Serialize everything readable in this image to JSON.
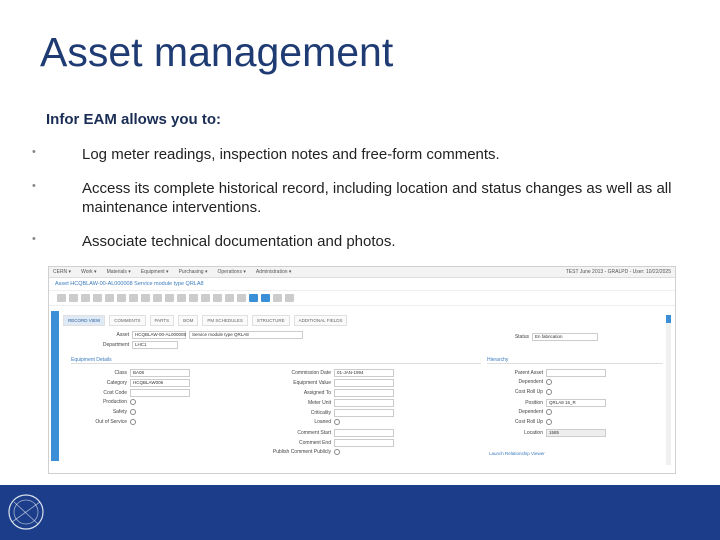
{
  "slide": {
    "title": "Asset management",
    "intro": "Infor EAM allows you to:",
    "bullets": [
      "Log meter readings, inspection notes and free-form comments.",
      "Access its complete historical record, including location and status changes as well as all maintenance interventions.",
      "Associate technical documentation and photos."
    ],
    "bullet_glyph": "•"
  },
  "screenshot": {
    "menu": [
      "CERN ▾",
      "Work ▾",
      "Materials ▾",
      "Equipment ▾",
      "Purchasing ▾",
      "Operations ▾",
      "Administration ▾"
    ],
    "session": "TEST June 2013 - GRALPD - User: 10/22/2025",
    "breadcrumb": "Asset HCQBLAW-00-AL000008 Service module type QRLA8",
    "tabs": [
      "RECORD VIEW",
      "COMMENTS",
      "PARTS",
      "BOM",
      "PM SCHEDULES",
      "STRUCTURE",
      "ADDITIONAL FIELDS"
    ],
    "active_tab": "RECORD VIEW",
    "asset_label": "Asset",
    "asset_code": "HCQBLAW-00-AL000008",
    "asset_desc": "Service module type QRLA8",
    "dept_label": "Department",
    "dept_value": "LHC1",
    "status_label": "Status",
    "status_value": "En fabrication",
    "section_equipment": "Equipment Details",
    "section_hierarchy": "Hierarchy",
    "left_fields": [
      {
        "label": "Class",
        "value": "BA08"
      },
      {
        "label": "Category",
        "value": "HCQBLAW006"
      },
      {
        "label": "Cost Code",
        "value": ""
      },
      {
        "label": "Production",
        "value": ""
      },
      {
        "label": "Safety",
        "value": ""
      },
      {
        "label": "Out of Service",
        "value": ""
      }
    ],
    "mid_fields": [
      {
        "label": "Commission Date",
        "value": "01-JAN-1994"
      },
      {
        "label": "Equipment Value",
        "value": ""
      },
      {
        "label": "Assigned To",
        "value": ""
      },
      {
        "label": "Meter Unit",
        "value": ""
      },
      {
        "label": "Criticality",
        "value": ""
      },
      {
        "label": "Loaned",
        "value": ""
      },
      {
        "label": "Comment Start",
        "value": ""
      },
      {
        "label": "Comment End",
        "value": ""
      },
      {
        "label": "Publish Comment Publicly",
        "value": ""
      }
    ],
    "right_fields": [
      {
        "label": "Parent Asset",
        "value": ""
      },
      {
        "label": "Dependent",
        "value": ""
      },
      {
        "label": "Cost Roll Up",
        "value": ""
      },
      {
        "label": "Position",
        "value": "QRLA8 15_R"
      },
      {
        "label": "Dependent",
        "value": ""
      },
      {
        "label": "Cost Roll Up",
        "value": ""
      },
      {
        "label": "Location",
        "value": "1585"
      }
    ],
    "link_text": "Launch Relationship Viewer"
  },
  "colors": {
    "title": "#1f3b73",
    "footer": "#1b3d8a",
    "accent": "#3a8fd6"
  },
  "icons": [
    "cern-logo",
    "toolbar-icons",
    "scroll-icon"
  ]
}
